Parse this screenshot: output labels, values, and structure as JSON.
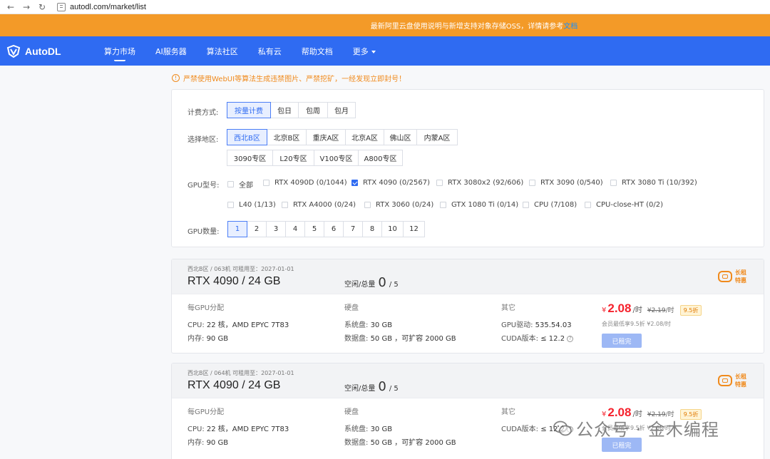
{
  "browser": {
    "url": "autodl.com/market/list"
  },
  "notice": {
    "text": "最新阿里云盘使用说明与新增支持对象存储OSS，详情请参考",
    "link": "文档"
  },
  "header": {
    "logo_text": "AutoDL",
    "nav": [
      "算力市场",
      "AI服务器",
      "算法社区",
      "私有云",
      "帮助文档",
      "更多"
    ]
  },
  "warning": {
    "icon": "!",
    "text": "严禁使用WebUI等算法生成违禁图片、严禁挖矿，一经发现立即封号！"
  },
  "filters": {
    "billing_label": "计费方式:",
    "billing_options": [
      "按量计费",
      "包日",
      "包周",
      "包月"
    ],
    "region_label": "选择地区:",
    "region_row1": [
      "西北B区",
      "北京B区",
      "重庆A区",
      "北京A区",
      "佛山区",
      "内蒙A区"
    ],
    "region_row2": [
      "3090专区",
      "L20专区",
      "V100专区",
      "A800专区"
    ],
    "gpu_label": "GPU型号:",
    "gpu_row1": [
      "全部",
      "RTX 4090D (0/1044)",
      "RTX 4090 (0/2567)",
      "RTX 3080x2 (92/606)",
      "RTX 3090 (0/540)",
      "RTX 3080 Ti (10/392)"
    ],
    "gpu_row2": [
      "L40 (1/13)",
      "RTX A4000 (0/24)",
      "RTX 3060 (0/24)",
      "GTX 1080 Ti (0/14)",
      "CPU (7/108)",
      "CPU-close-HT (0/2)"
    ],
    "count_label": "GPU数量:",
    "counts": [
      "1",
      "2",
      "3",
      "4",
      "5",
      "6",
      "7",
      "8",
      "10",
      "12"
    ]
  },
  "cards": [
    {
      "meta": "西北B区 / 063机    可租用至：2027-01-01",
      "title": "RTX 4090 / 24 GB",
      "avail_label": "空闲/总量",
      "avail": "0",
      "total": "/ 5",
      "badge": "长租特惠",
      "col1_head": "每GPU分配",
      "cpu_k": "CPU:",
      "cpu_v": "22 核，AMD EPYC 7T83",
      "mem_k": "内存:",
      "mem_v": "90 GB",
      "col2_head": "硬盘",
      "sys_k": "系统盘:",
      "sys_v": "30 GB",
      "data_k": "数据盘:",
      "data_v": "50 GB ，可扩容 2000 GB",
      "col3_head": "其它",
      "drv_k": "GPU驱动:",
      "drv_v": "535.54.03",
      "cuda_k": "CUDA版本:",
      "cuda_v": "≤ 12.2",
      "cur": "¥",
      "price": "2.08",
      "unit": "/时",
      "old_price": "¥2.19",
      "old_unit": "/时",
      "discount": "9.5折",
      "member": "会员最低享9.5折  ¥2.08/时",
      "button": "已租完"
    },
    {
      "meta": "西北B区 / 064机    可租用至：2027-01-01",
      "title": "RTX 4090 / 24 GB",
      "avail_label": "空闲/总量",
      "avail": "0",
      "total": "/ 5",
      "badge": "长租特惠",
      "col1_head": "每GPU分配",
      "cpu_k": "CPU:",
      "cpu_v": "22 核，AMD EPYC 7T83",
      "mem_k": "内存:",
      "mem_v": "90 GB",
      "col2_head": "硬盘",
      "sys_k": "系统盘:",
      "sys_v": "30 GB",
      "data_k": "数据盘:",
      "data_v": "50 GB ，可扩容 2000 GB",
      "col3_head": "其它",
      "cuda_k": "CUDA版本:",
      "cuda_v": "≤ 12.2",
      "cur": "¥",
      "price": "2.08",
      "unit": "/时",
      "old_price": "¥2.19",
      "old_unit": "/时",
      "discount": "9.5折",
      "member": "会员最低享9.5折  ¥2.08/时",
      "button": "已租完"
    }
  ],
  "watermark": {
    "text": "公众号 · 金木编程"
  }
}
